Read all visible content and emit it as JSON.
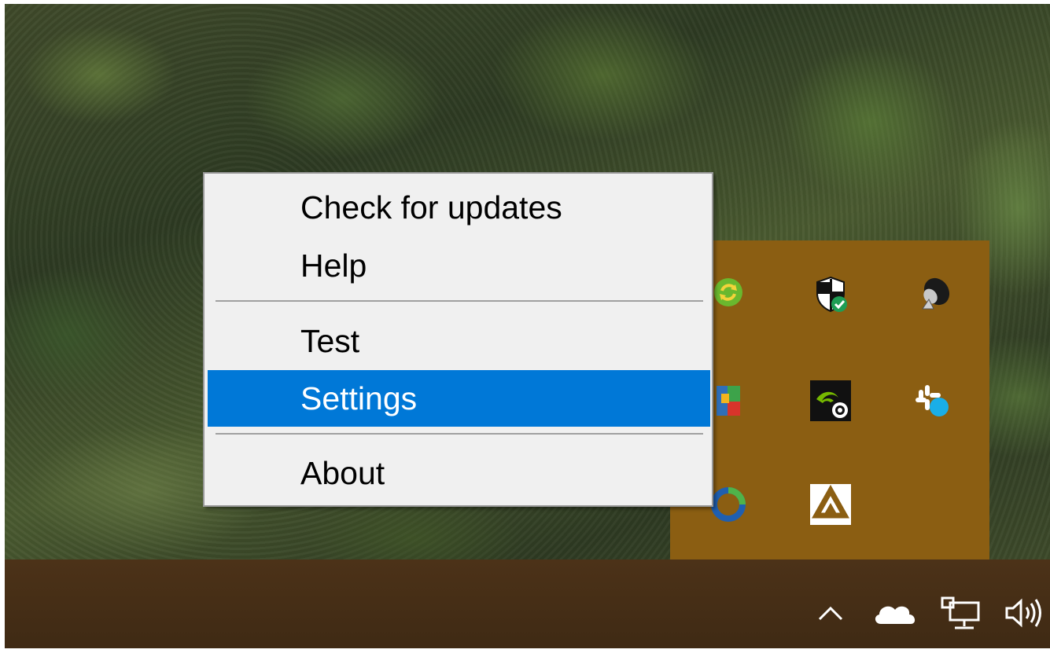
{
  "menu": {
    "items": [
      {
        "label": "Check for updates"
      },
      {
        "label": "Help"
      },
      {
        "label": "Test"
      },
      {
        "label": "Settings",
        "highlighted": true
      },
      {
        "label": "About"
      }
    ],
    "highlight_color": "#0078d7"
  },
  "tray_overflow": {
    "background": "#8b5e12",
    "icons": [
      "green-sync-icon",
      "windows-defender-shield-icon",
      "speaker-satellite-icon",
      "colored-app-icon",
      "nvidia-share-icon",
      "slack-status-icon",
      "blue-ring-app-icon",
      "google-drive-icon"
    ]
  },
  "taskbar": {
    "icons": [
      "chevron-up-icon",
      "onedrive-cloud-icon",
      "network-icon",
      "volume-icon"
    ]
  }
}
